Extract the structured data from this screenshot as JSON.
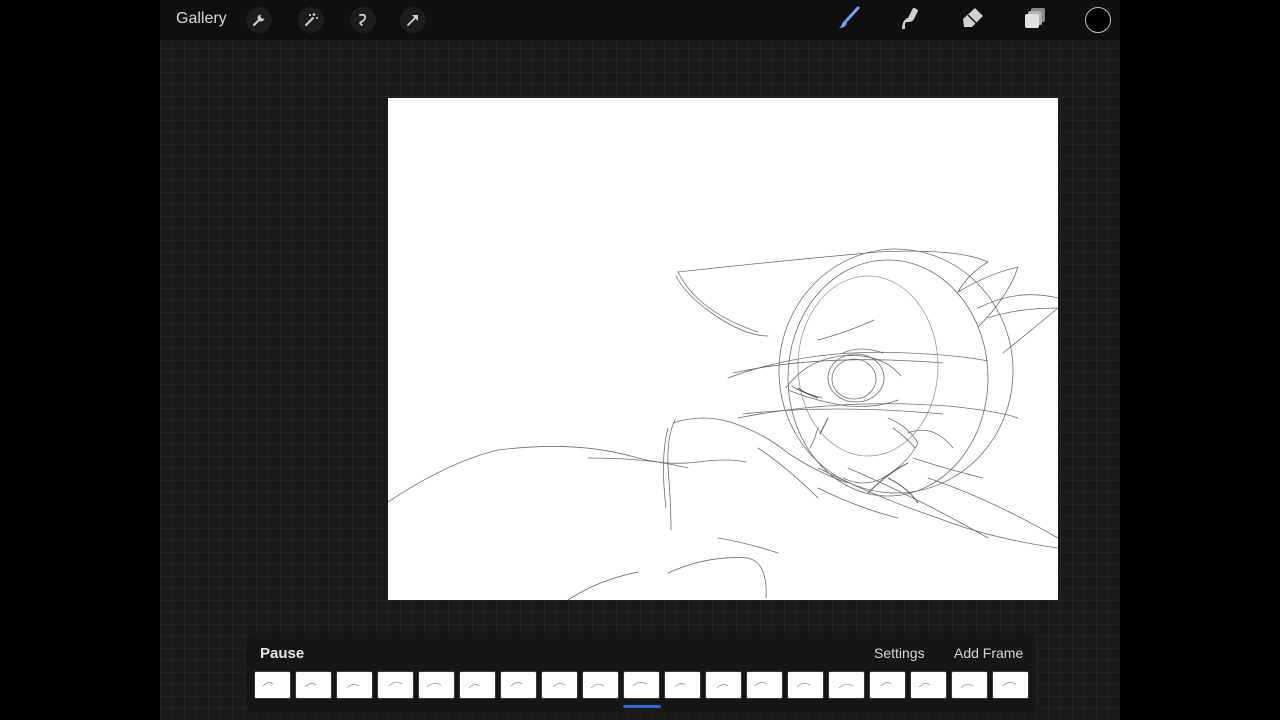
{
  "topbar": {
    "gallery_label": "Gallery",
    "left_tools": [
      {
        "name": "wrench-icon"
      },
      {
        "name": "magic-wand-icon"
      },
      {
        "name": "selection-icon"
      },
      {
        "name": "transform-arrow-icon"
      }
    ],
    "right_tools": [
      {
        "name": "brush-icon"
      },
      {
        "name": "smudge-icon"
      },
      {
        "name": "eraser-icon"
      },
      {
        "name": "layers-icon"
      }
    ],
    "current_color": "#000000"
  },
  "animation_panel": {
    "pause_label": "Pause",
    "settings_label": "Settings",
    "add_frame_label": "Add Frame",
    "frame_count": 19,
    "current_frame_index": 9,
    "accent_color": "#2c6bd6"
  }
}
